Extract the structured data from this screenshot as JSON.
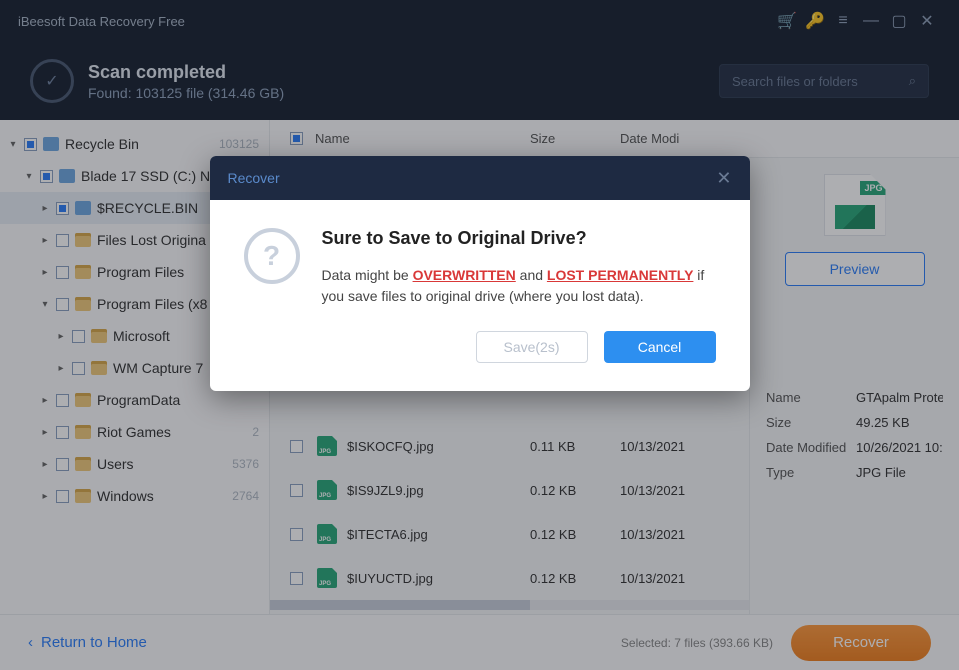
{
  "app_title": "iBeesoft Data Recovery Free",
  "header": {
    "title": "Scan completed",
    "subtitle": "Found: 103125 file (314.46 GB)"
  },
  "search": {
    "placeholder": "Search files or folders"
  },
  "columns": {
    "name": "Name",
    "size": "Size",
    "date": "Date Modi"
  },
  "tree": [
    {
      "label": "Recycle Bin",
      "count": "103125",
      "indent": 0,
      "twisty": "▾",
      "ind": true,
      "rb": true
    },
    {
      "label": "Blade 17 SSD (C:) N",
      "count": "",
      "indent": 1,
      "twisty": "▾",
      "ind": true,
      "rb": true
    },
    {
      "label": "$RECYCLE.BIN",
      "count": "",
      "indent": 2,
      "twisty": "▸",
      "ind": true,
      "rb": true,
      "sel": true
    },
    {
      "label": "Files Lost Origina",
      "count": "",
      "indent": 2,
      "twisty": "▸",
      "ind": false
    },
    {
      "label": "Program Files",
      "count": "",
      "indent": 2,
      "twisty": "▸",
      "ind": false
    },
    {
      "label": "Program Files (x8",
      "count": "",
      "indent": 2,
      "twisty": "▾",
      "ind": false
    },
    {
      "label": "Microsoft",
      "count": "",
      "indent": 3,
      "twisty": "▸",
      "ind": false
    },
    {
      "label": "WM Capture 7",
      "count": "",
      "indent": 3,
      "twisty": "▸",
      "ind": false
    },
    {
      "label": "ProgramData",
      "count": "",
      "indent": 2,
      "twisty": "▸",
      "ind": false
    },
    {
      "label": "Riot Games",
      "count": "2",
      "indent": 2,
      "twisty": "▸",
      "ind": false
    },
    {
      "label": "Users",
      "count": "5376",
      "indent": 2,
      "twisty": "▸",
      "ind": false
    },
    {
      "label": "Windows",
      "count": "2764",
      "indent": 2,
      "twisty": "▸",
      "ind": false
    }
  ],
  "files": [
    {
      "name": "$ISKOCFQ.jpg",
      "size": "0.11 KB",
      "date": "10/13/2021"
    },
    {
      "name": "$IS9JZL9.jpg",
      "size": "0.12 KB",
      "date": "10/13/2021"
    },
    {
      "name": "$ITECTA6.jpg",
      "size": "0.12 KB",
      "date": "10/13/2021"
    },
    {
      "name": "$IUYUCTD.jpg",
      "size": "0.12 KB",
      "date": "10/13/2021"
    }
  ],
  "preview_btn": "Preview",
  "details": {
    "name_k": "Name",
    "name_v": "GTApalm Prote",
    "size_k": "Size",
    "size_v": "49.25 KB",
    "date_k": "Date Modified",
    "date_v": "10/26/2021 10:",
    "type_k": "Type",
    "type_v": "JPG File",
    "jpg_badge": "JPG"
  },
  "footer": {
    "return": "Return to Home",
    "selected": "Selected: 7 files (393.66 KB)",
    "recover": "Recover"
  },
  "modal": {
    "head": "Recover",
    "title": "Sure to Save to Original Drive?",
    "pre": "Data might be ",
    "w1": "OVERWRITTEN",
    "mid": " and ",
    "w2": "LOST PERMANENTLY",
    "post": " if you save files to original drive (where you lost data).",
    "save": "Save(2s)",
    "cancel": "Cancel"
  }
}
